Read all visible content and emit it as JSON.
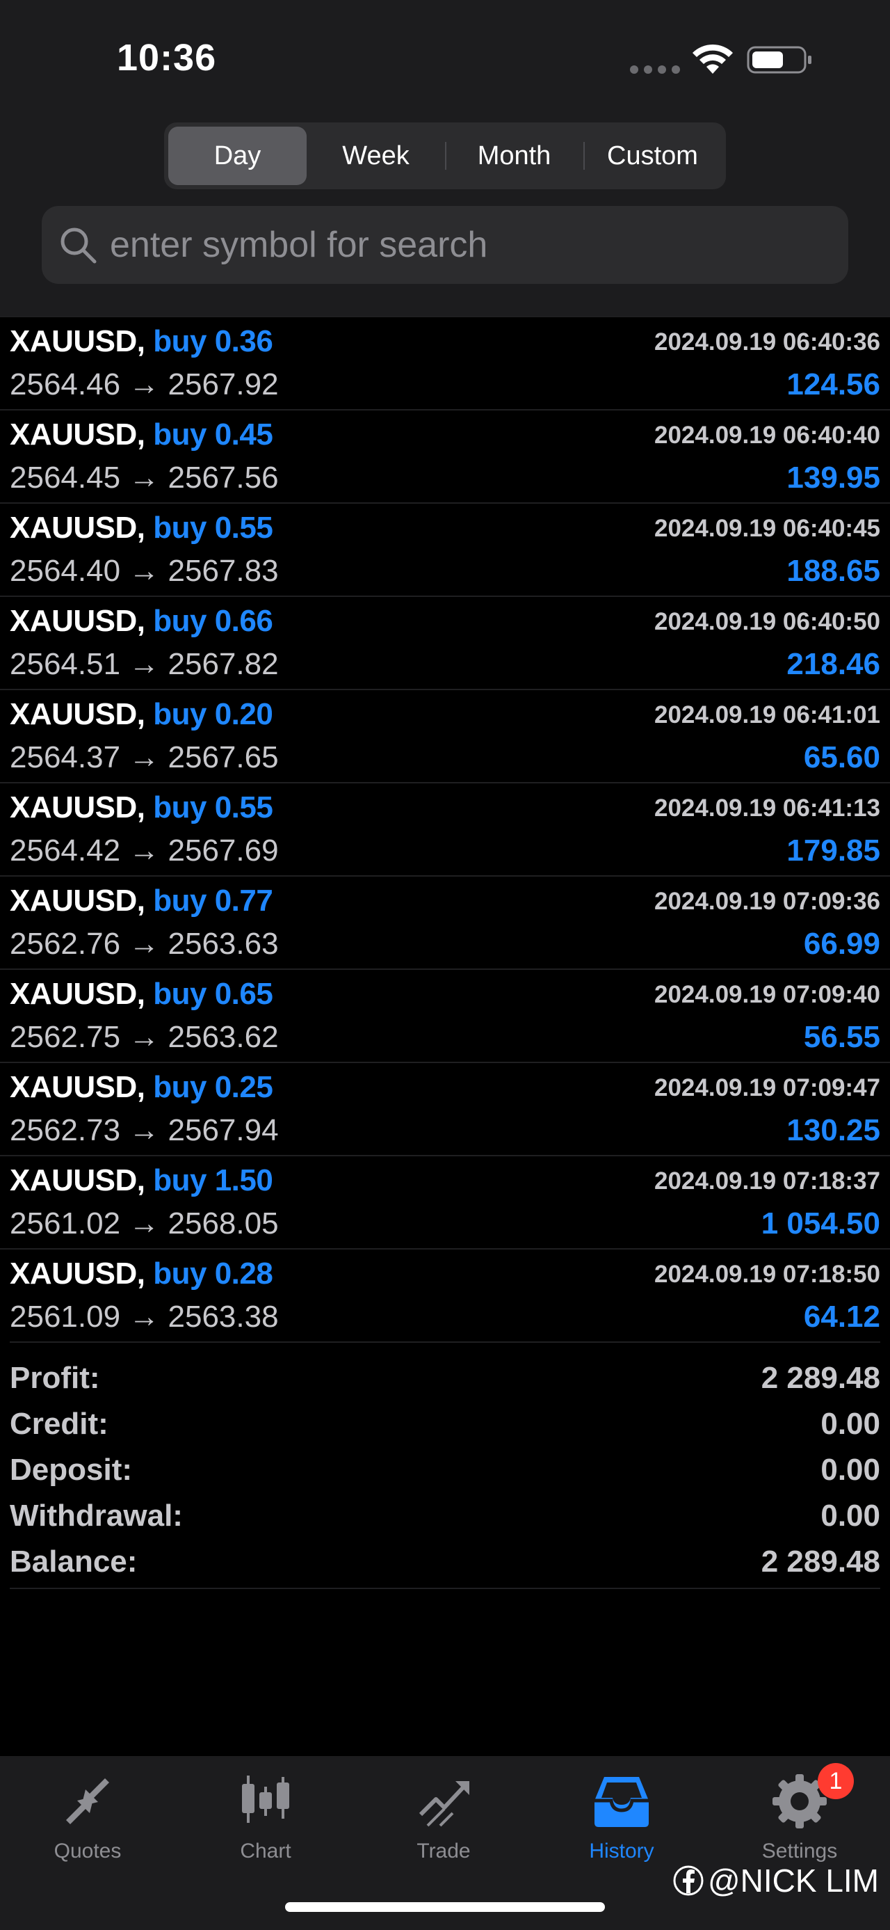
{
  "status_bar": {
    "time": "10:36"
  },
  "period_tabs": [
    {
      "label": "Day",
      "active": true
    },
    {
      "label": "Week",
      "active": false
    },
    {
      "label": "Month",
      "active": false
    },
    {
      "label": "Custom",
      "active": false
    }
  ],
  "search": {
    "placeholder": "enter symbol for search",
    "value": ""
  },
  "trades": [
    {
      "symbol": "XAUUSD,",
      "side": "buy 0.36",
      "prices": "2564.46 → 2567.92",
      "time": "2024.09.19 06:40:36",
      "profit": "124.56"
    },
    {
      "symbol": "XAUUSD,",
      "side": "buy 0.45",
      "prices": "2564.45 → 2567.56",
      "time": "2024.09.19 06:40:40",
      "profit": "139.95"
    },
    {
      "symbol": "XAUUSD,",
      "side": "buy 0.55",
      "prices": "2564.40 → 2567.83",
      "time": "2024.09.19 06:40:45",
      "profit": "188.65"
    },
    {
      "symbol": "XAUUSD,",
      "side": "buy 0.66",
      "prices": "2564.51 → 2567.82",
      "time": "2024.09.19 06:40:50",
      "profit": "218.46"
    },
    {
      "symbol": "XAUUSD,",
      "side": "buy 0.20",
      "prices": "2564.37 → 2567.65",
      "time": "2024.09.19 06:41:01",
      "profit": "65.60"
    },
    {
      "symbol": "XAUUSD,",
      "side": "buy 0.55",
      "prices": "2564.42 → 2567.69",
      "time": "2024.09.19 06:41:13",
      "profit": "179.85"
    },
    {
      "symbol": "XAUUSD,",
      "side": "buy 0.77",
      "prices": "2562.76 → 2563.63",
      "time": "2024.09.19 07:09:36",
      "profit": "66.99"
    },
    {
      "symbol": "XAUUSD,",
      "side": "buy 0.65",
      "prices": "2562.75 → 2563.62",
      "time": "2024.09.19 07:09:40",
      "profit": "56.55"
    },
    {
      "symbol": "XAUUSD,",
      "side": "buy 0.25",
      "prices": "2562.73 → 2567.94",
      "time": "2024.09.19 07:09:47",
      "profit": "130.25"
    },
    {
      "symbol": "XAUUSD,",
      "side": "buy 1.50",
      "prices": "2561.02 → 2568.05",
      "time": "2024.09.19 07:18:37",
      "profit": "1 054.50"
    },
    {
      "symbol": "XAUUSD,",
      "side": "buy 0.28",
      "prices": "2561.09 → 2563.38",
      "time": "2024.09.19 07:18:50",
      "profit": "64.12"
    }
  ],
  "summary": [
    {
      "label": "Profit:",
      "value": "2 289.48"
    },
    {
      "label": "Credit:",
      "value": "0.00"
    },
    {
      "label": "Deposit:",
      "value": "0.00"
    },
    {
      "label": "Withdrawal:",
      "value": "0.00"
    },
    {
      "label": "Balance:",
      "value": "2 289.48"
    }
  ],
  "tabbar": {
    "items": [
      {
        "label": "Quotes",
        "icon": "quotes-icon",
        "active": false
      },
      {
        "label": "Chart",
        "icon": "chart-icon",
        "active": false
      },
      {
        "label": "Trade",
        "icon": "trade-icon",
        "active": false
      },
      {
        "label": "History",
        "icon": "history-icon",
        "active": true
      },
      {
        "label": "Settings",
        "icon": "settings-icon",
        "active": false
      }
    ],
    "settings_badge": "1"
  },
  "watermark": "@NICK LIM",
  "colors": {
    "accent": "#1f87ff",
    "background": "#000000",
    "header": "#1c1c1e",
    "badge": "#ff3b30"
  }
}
